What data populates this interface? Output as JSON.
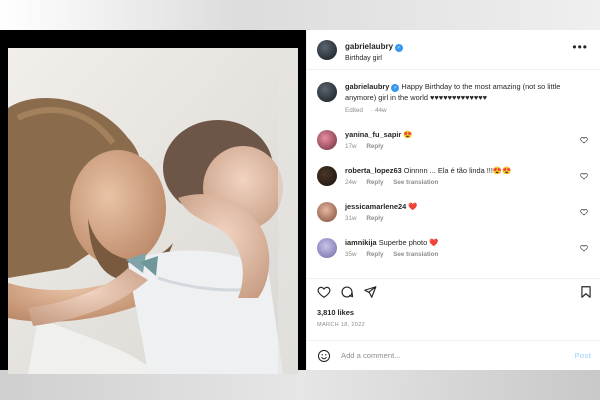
{
  "post": {
    "username": "gabrielaubry",
    "subtitle": "Birthday girl",
    "more_label": "•••",
    "caption_username": "gabrielaubry",
    "caption_text": "Happy Birthday to the most amazing (not so little anymore) girl in the world ♥♥♥♥♥♥♥♥♥♥♥♥♥",
    "caption_meta_edited": "Edited",
    "caption_meta_time": "44w",
    "likes": "3,810 likes",
    "date": "MARCH 18, 2022"
  },
  "comments": [
    {
      "username": "yanina_fu_sapir",
      "text": "😍",
      "time": "17w",
      "reply": "Reply",
      "translation": ""
    },
    {
      "username": "roberta_lopez63",
      "text": "Oinnnn ... Ela é tão linda !!!😍😍",
      "time": "24w",
      "reply": "Reply",
      "translation": "See translation"
    },
    {
      "username": "jessicamarlene24",
      "text": "❤️",
      "time": "31w",
      "reply": "Reply",
      "translation": ""
    },
    {
      "username": "iamnikija",
      "text": "Superbe photo ❤️",
      "time": "35w",
      "reply": "Reply",
      "translation": "See translation"
    }
  ],
  "add_comment": {
    "placeholder": "Add a comment...",
    "post_label": "Post"
  },
  "icons": {
    "like": "heart-icon",
    "comment": "comment-icon",
    "share": "share-icon",
    "save": "bookmark-icon",
    "emoji": "smiley-icon",
    "verified": "verified-badge-icon"
  },
  "colors": {
    "verified": "#3897f0",
    "link_disabled": "#b2dffc",
    "muted": "#8e8e8e",
    "text": "#262626",
    "heart": "#ed4956"
  }
}
